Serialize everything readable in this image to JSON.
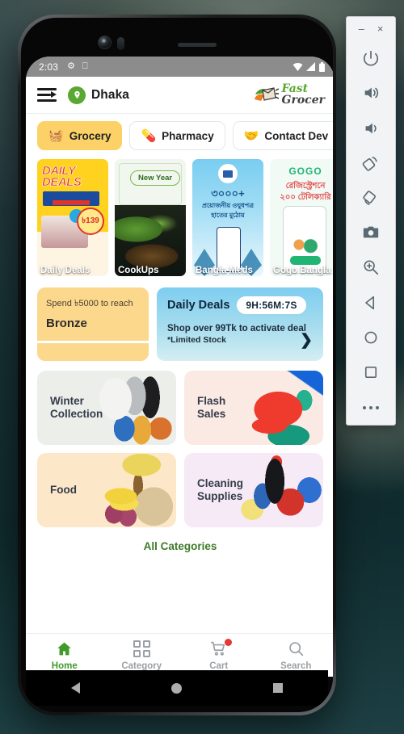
{
  "emulator_toolbar": {
    "minimize_label": "–",
    "close_label": "×",
    "buttons": [
      {
        "name": "power",
        "label": "Power"
      },
      {
        "name": "volume-up",
        "label": "Volume Up"
      },
      {
        "name": "volume-down",
        "label": "Volume Down"
      },
      {
        "name": "rotate-left",
        "label": "Rotate Left"
      },
      {
        "name": "rotate-right",
        "label": "Rotate Right"
      },
      {
        "name": "screenshot",
        "label": "Take Screenshot"
      },
      {
        "name": "zoom",
        "label": "Zoom Mode"
      },
      {
        "name": "back",
        "label": "Back"
      },
      {
        "name": "home",
        "label": "Home"
      },
      {
        "name": "overview",
        "label": "Overview"
      },
      {
        "name": "more",
        "label": "More"
      }
    ]
  },
  "status_bar": {
    "time": "2:03",
    "left_icons": [
      "debug-icon",
      "usb-icon"
    ],
    "right_icons": [
      "wifi-icon",
      "signal-icon",
      "battery-icon"
    ]
  },
  "app_header": {
    "menu_icon": "hamburger-menu-icon",
    "location_icon": "location-pin-icon",
    "location": "Dhaka",
    "brand_line1": "Fast",
    "brand_line2": "Grocer",
    "brand_logo_icon": "grocery-bag-carrot-icon"
  },
  "chips": [
    {
      "label": "Grocery",
      "icon": "basket-emoji",
      "glyph": "🧺",
      "active": true
    },
    {
      "label": "Pharmacy",
      "icon": "pill-bottle-emoji",
      "glyph": "💊",
      "active": false
    },
    {
      "label": "Contact Dev",
      "icon": "handshake-emoji",
      "glyph": "🤝",
      "active": false
    }
  ],
  "banners": [
    {
      "caption": "Daily Deals",
      "headline": "DAILY DEALS",
      "offer": "BUY 1 GET 1 FREE",
      "price": "৳139"
    },
    {
      "caption": "CookUps",
      "tag": "New Year"
    },
    {
      "caption": "Bangla Meds",
      "headline": "৩০০০+",
      "line1": "প্রয়োজনীয় ওঘুধপত্র",
      "line2": "হাতের মুঠোয়"
    },
    {
      "caption": "Gogo Bangla",
      "logo": "GOGO",
      "line1": "রেজিস্ট্রেশনে",
      "line2": "২০০ টেলিক্যারি"
    }
  ],
  "bronze_card": {
    "subtitle": "Spend ৳5000 to reach",
    "tier": "Bronze"
  },
  "daily_deals_card": {
    "title": "Daily Deals",
    "timer": "9H:56M:7S",
    "line1": "Shop over 99Tk to activate deal",
    "line2": "*Limited Stock",
    "chevron_icon": "chevron-right-icon"
  },
  "tiles": [
    {
      "label": "Winter\nCollection",
      "art": "art-winter",
      "bg": "t-winter"
    },
    {
      "label": "Flash\nSales",
      "art": "art-flash",
      "bg": "t-flash"
    },
    {
      "label": "Food",
      "art": "art-food",
      "bg": "t-food"
    },
    {
      "label": "Cleaning\nSupplies",
      "art": "art-clean",
      "bg": "t-clean"
    }
  ],
  "all_categories_label": "All Categories",
  "bottom_nav": [
    {
      "label": "Home",
      "icon": "home-icon",
      "active": true,
      "badge": false
    },
    {
      "label": "Category",
      "icon": "grid-icon",
      "active": false,
      "badge": false
    },
    {
      "label": "Cart",
      "icon": "cart-icon",
      "active": false,
      "badge": true
    },
    {
      "label": "Search",
      "icon": "search-icon",
      "active": false,
      "badge": false
    }
  ],
  "system_nav": [
    {
      "name": "back",
      "icon": "triangle-back-icon"
    },
    {
      "name": "home",
      "icon": "circle-home-icon"
    },
    {
      "name": "recents",
      "icon": "square-recents-icon"
    }
  ],
  "colors": {
    "accent_green": "#3f9a29",
    "chip_active": "#fcd268",
    "bronze": "#fcd88d",
    "deals_blue": "#7ecdf0",
    "badge_red": "#e53935"
  }
}
